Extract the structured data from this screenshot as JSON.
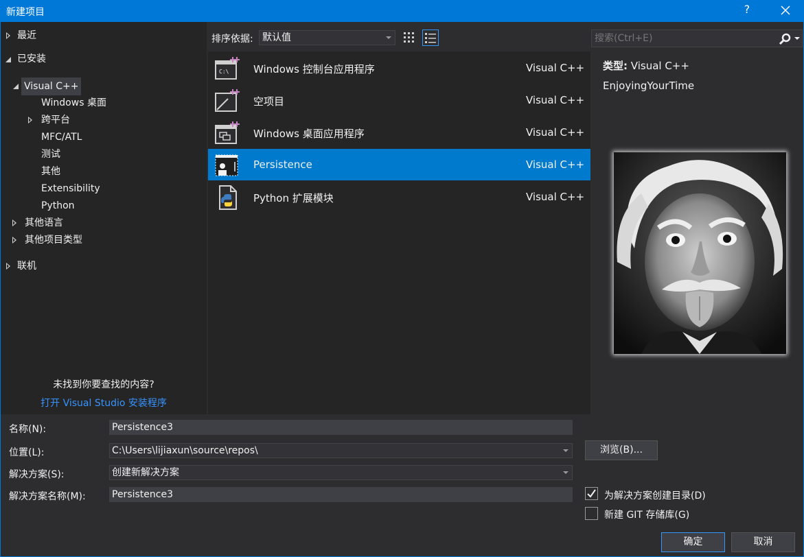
{
  "window": {
    "title": "新建项目",
    "help": "?"
  },
  "tree": {
    "recent": "最近",
    "installed": "已安装",
    "visual_cpp": "Visual C++",
    "children": [
      "Windows 桌面",
      "跨平台",
      "MFC/ATL",
      "测试",
      "其他",
      "Extensibility",
      "Python"
    ],
    "other_languages": "其他语言",
    "other_project_types": "其他项目类型",
    "online": "联机",
    "not_found_text": "未找到你要查找的内容?",
    "open_installer_link": "打开 Visual Studio 安装程序"
  },
  "toolbar": {
    "sort_label": "排序依据:",
    "sort_value": "默认值"
  },
  "templates": [
    {
      "name": "Windows 控制台应用程序",
      "lang": "Visual C++",
      "icon": "console-app-icon"
    },
    {
      "name": "空项目",
      "lang": "Visual C++",
      "icon": "empty-project-icon"
    },
    {
      "name": "Windows 桌面应用程序",
      "lang": "Visual C++",
      "icon": "desktop-app-icon"
    },
    {
      "name": "Persistence",
      "lang": "Visual C++",
      "icon": "persistence-template-icon",
      "selected": true
    },
    {
      "name": "Python 扩展模块",
      "lang": "Visual C++",
      "icon": "python-extension-icon"
    }
  ],
  "details": {
    "search_placeholder": "搜索(Ctrl+E)",
    "type_label": "类型:",
    "type_value": "Visual C++",
    "description": "EnjoyingYourTime"
  },
  "form": {
    "name_label": "名称(N):",
    "name_value": "Persistence3",
    "location_label": "位置(L):",
    "location_value": "C:\\Users\\lijiaxun\\source\\repos\\",
    "solution_label": "解决方案(S):",
    "solution_value": "创建新解决方案",
    "solution_name_label": "解决方案名称(M):",
    "solution_name_value": "Persistence3",
    "browse_label": "浏览(B)...",
    "create_dir_label": "为解决方案创建目录(D)",
    "create_dir_checked": true,
    "git_label": "新建 GIT 存储库(G)",
    "git_checked": false,
    "ok_label": "确定",
    "cancel_label": "取消"
  },
  "colors": {
    "accent": "#0078d7",
    "selection": "#007acc",
    "link": "#3794ff",
    "background": "#2d2d30",
    "panel": "#252526"
  }
}
